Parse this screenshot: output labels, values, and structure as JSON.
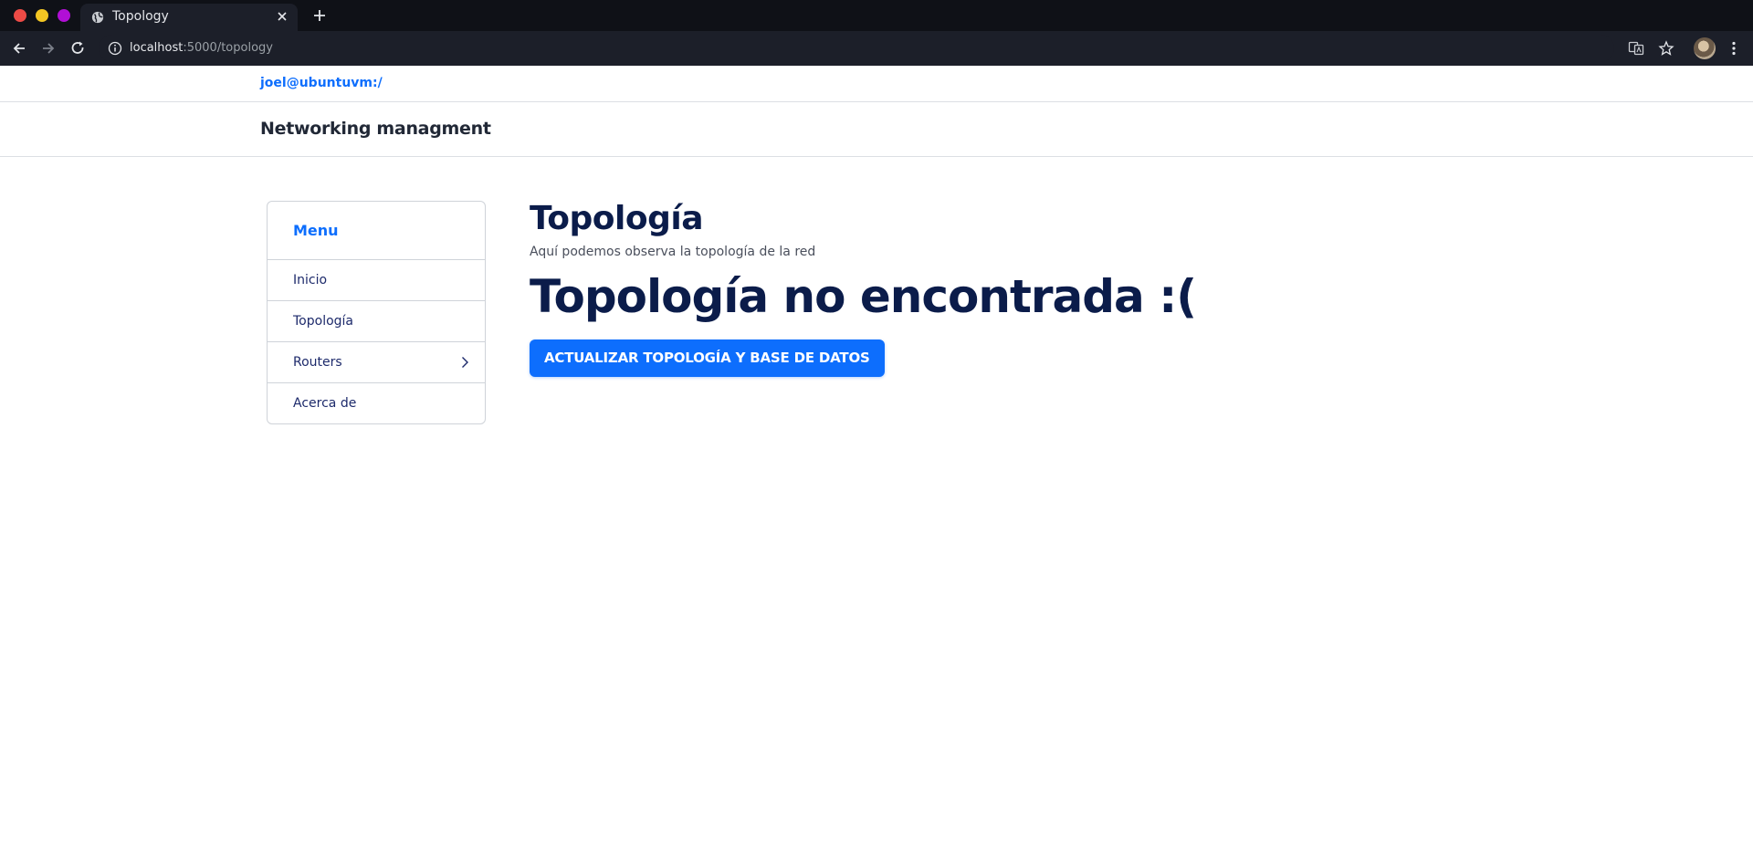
{
  "browser": {
    "tab_title": "Topology",
    "url_host": "localhost",
    "url_path": ":5000/topology"
  },
  "page": {
    "user_link": "joel@ubuntuvm:/",
    "brand": "Networking managment"
  },
  "sidebar": {
    "title": "Menu",
    "items": [
      {
        "label": "Inicio"
      },
      {
        "label": "Topología"
      },
      {
        "label": "Routers"
      },
      {
        "label": "Acerca de"
      }
    ]
  },
  "main": {
    "title": "Topología",
    "subtitle": "Aquí podemos observa la topología de la red",
    "message": "Topología no encontrada :(",
    "action_label": "ACTUALIZAR TOPOLOGÍA Y BASE DE DATOS"
  },
  "colors": {
    "accent": "#0d6efd",
    "heading": "#0b1c4a",
    "chrome_dark": "#1c1f29"
  }
}
